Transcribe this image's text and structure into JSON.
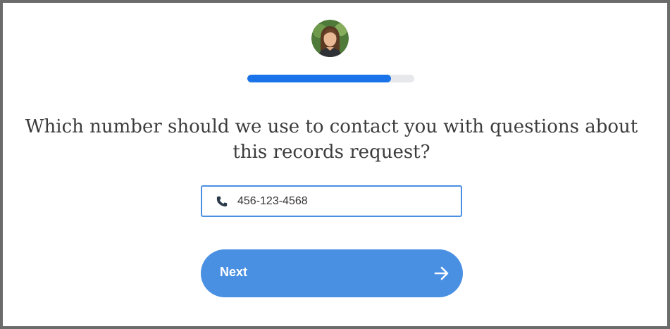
{
  "avatar": {
    "icon": "user-photo-avatar"
  },
  "progress": {
    "percent": 86,
    "fill_color": "#1a73e8",
    "track_color": "#e6e8ec"
  },
  "question": {
    "text": "Which number should we use to contact you with questions about this records request?"
  },
  "phone_field": {
    "icon": "phone-icon",
    "value": "456-123-4568"
  },
  "next_button": {
    "label": "Next",
    "icon": "arrow-right-icon",
    "color": "#4a90e2"
  }
}
